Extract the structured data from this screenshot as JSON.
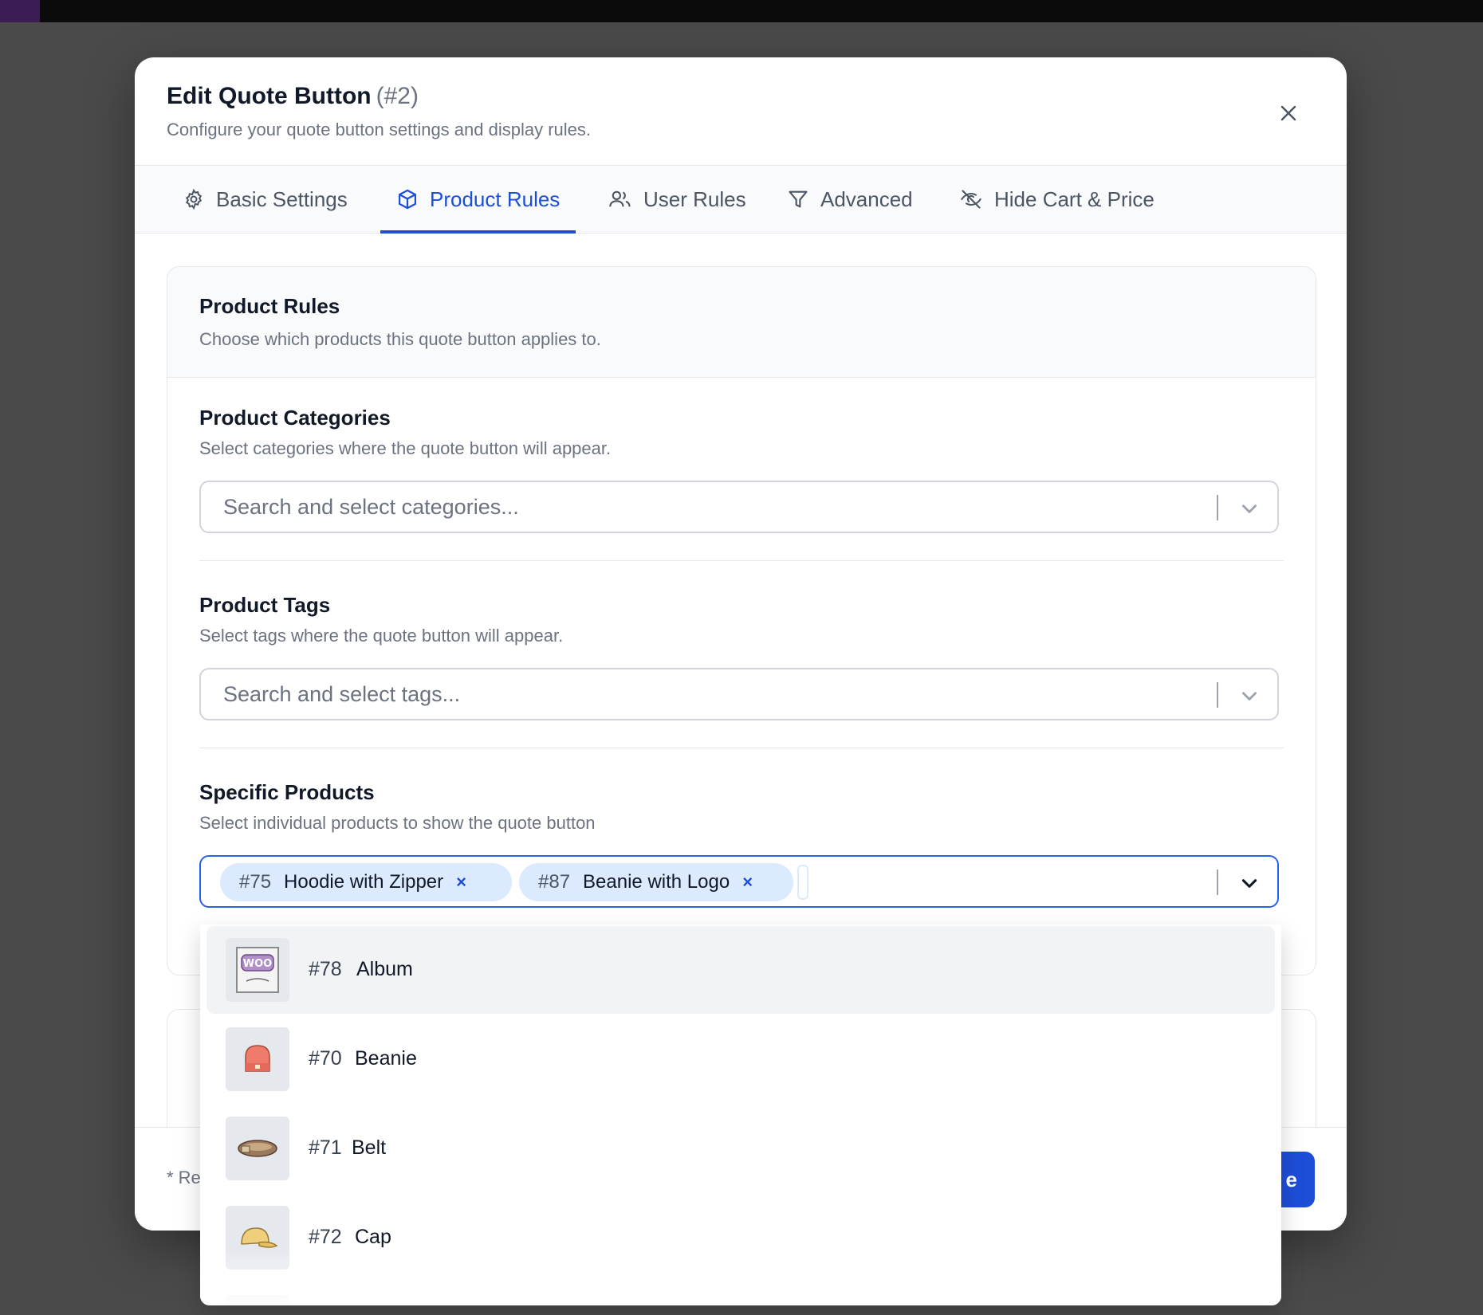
{
  "colors": {
    "accent": "#1d4ed8",
    "chip_bg": "#dbeafe",
    "muted": "#6b7280",
    "title": "#111827"
  },
  "modal": {
    "title": "Edit Quote Button",
    "id_label": "(#2)",
    "subtitle": "Configure your quote button settings and display rules.",
    "close_icon": "close-icon"
  },
  "tabs": [
    {
      "label": "Basic Settings",
      "icon": "gear-icon",
      "active": false
    },
    {
      "label": "Product Rules",
      "icon": "box-icon",
      "active": true
    },
    {
      "label": "User Rules",
      "icon": "users-icon",
      "active": false
    },
    {
      "label": "Advanced",
      "icon": "filter-icon",
      "active": false
    },
    {
      "label": "Hide Cart & Price",
      "icon": "eye-off-icon",
      "active": false
    }
  ],
  "card": {
    "title": "Product Rules",
    "subtitle": "Choose which products this quote button applies to.",
    "categories": {
      "title": "Product Categories",
      "description": "Select categories where the quote button will appear.",
      "placeholder": "Search and select categories..."
    },
    "tags": {
      "title": "Product Tags",
      "description": "Select tags where the quote button will appear.",
      "placeholder": "Search and select tags..."
    },
    "products": {
      "title": "Specific Products",
      "description": "Select individual products to show the quote button",
      "selected": [
        {
          "id": "#75",
          "name": "Hoodie with Zipper",
          "remove": "×"
        },
        {
          "id": "#87",
          "name": "Beanie with Logo",
          "remove": "×"
        }
      ]
    }
  },
  "dropdown": {
    "options": [
      {
        "id": "#78",
        "name": "Album",
        "thumb": "woo-album-thumb",
        "highlighted": true
      },
      {
        "id": "#70",
        "name": "Beanie",
        "thumb": "beanie-thumb",
        "highlighted": false
      },
      {
        "id": "#71",
        "name": "Belt",
        "thumb": "belt-thumb",
        "highlighted": false
      },
      {
        "id": "#72",
        "name": "Cap",
        "thumb": "cap-thumb",
        "highlighted": false
      }
    ]
  },
  "footer": {
    "note": "* Re",
    "save_label": "e"
  }
}
